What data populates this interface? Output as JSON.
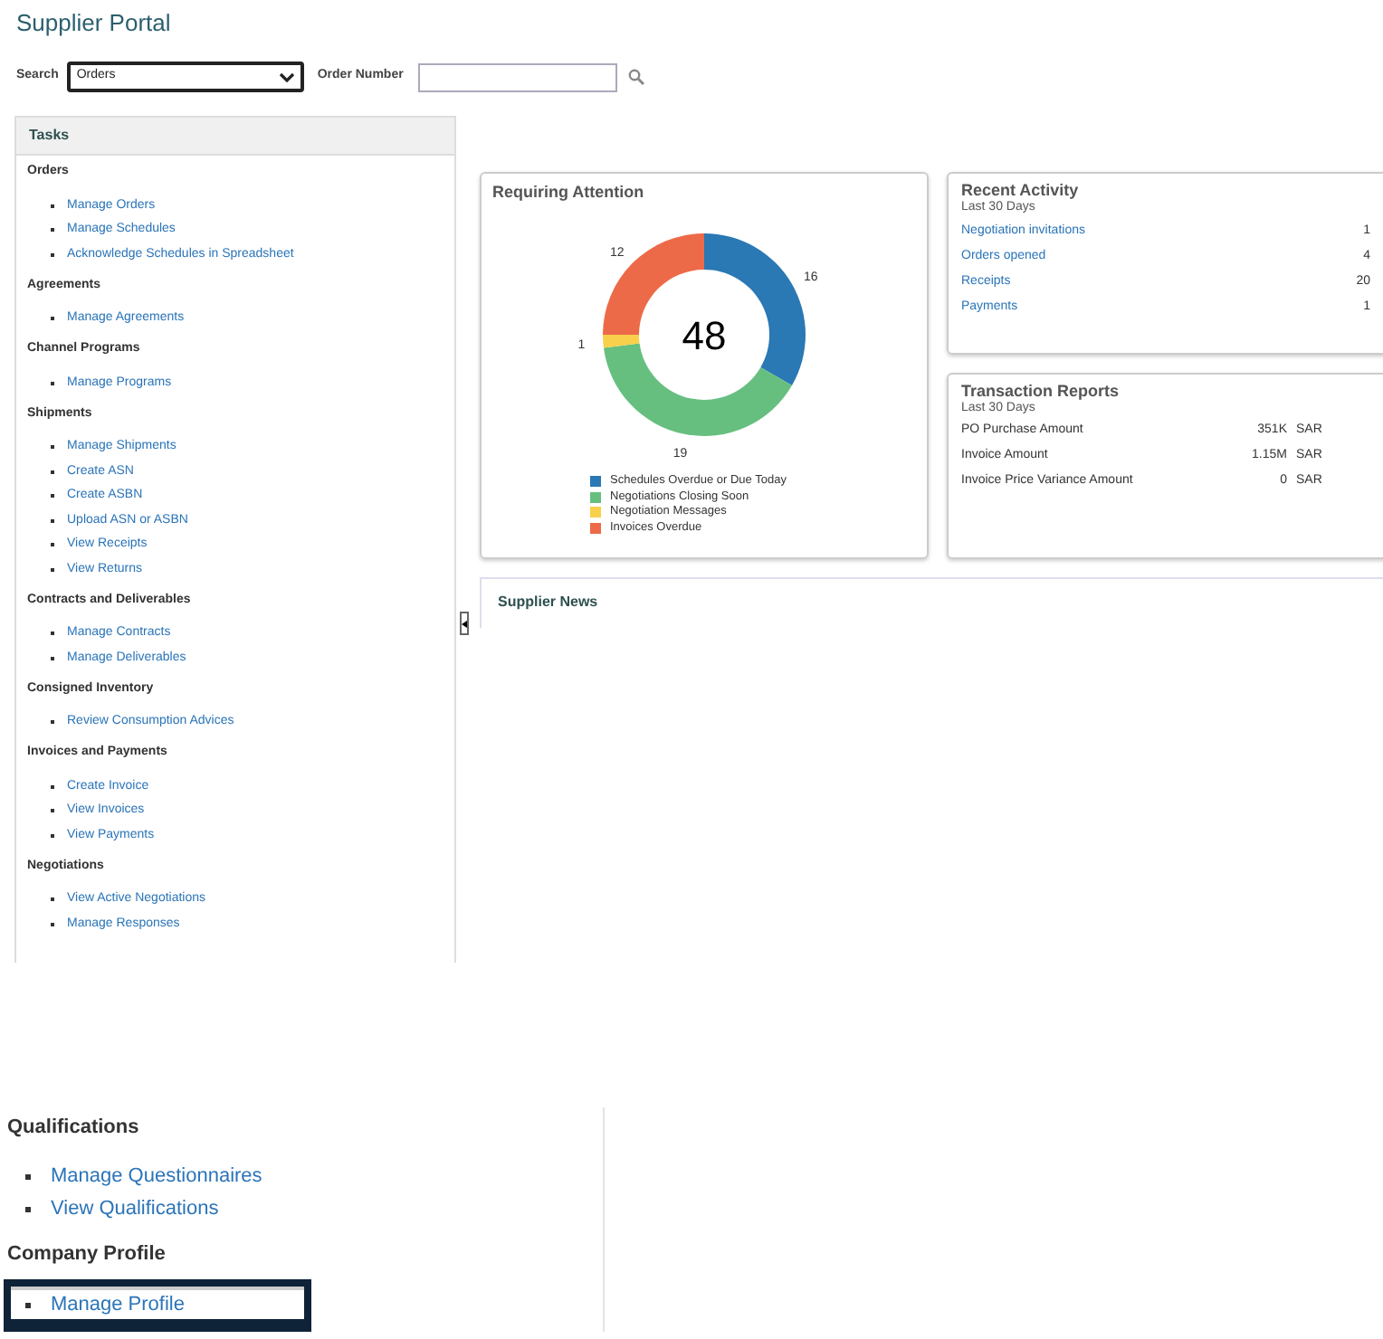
{
  "page_title": "Supplier Portal",
  "search": {
    "label": "Search",
    "value": "Orders",
    "order_number_label": "Order Number"
  },
  "tasks": {
    "title": "Tasks",
    "groups": [
      {
        "heading": "Orders",
        "links": [
          "Manage Orders",
          "Manage Schedules",
          "Acknowledge Schedules in Spreadsheet"
        ]
      },
      {
        "heading": "Agreements",
        "links": [
          "Manage Agreements"
        ]
      },
      {
        "heading": "Channel Programs",
        "links": [
          "Manage Programs"
        ]
      },
      {
        "heading": "Shipments",
        "links": [
          "Manage Shipments",
          "Create ASN",
          "Create ASBN",
          "Upload ASN or ASBN",
          "View Receipts",
          "View Returns"
        ]
      },
      {
        "heading": "Contracts and Deliverables",
        "links": [
          "Manage Contracts",
          "Manage Deliverables"
        ]
      },
      {
        "heading": "Consigned Inventory",
        "links": [
          "Review Consumption Advices"
        ]
      },
      {
        "heading": "Invoices and Payments",
        "links": [
          "Create Invoice",
          "View Invoices",
          "View Payments"
        ]
      },
      {
        "heading": "Negotiations",
        "links": [
          "View Active Negotiations",
          "Manage Responses"
        ]
      }
    ]
  },
  "requiring_attention": {
    "title": "Requiring Attention",
    "total": "48",
    "chart_data": {
      "type": "donut",
      "categories": [
        "Schedules Overdue or Due Today",
        "Negotiations Closing Soon",
        "Negotiation Messages",
        "Invoices Overdue"
      ],
      "values": [
        16,
        19,
        1,
        12
      ],
      "data_labels": true
    },
    "legend": [
      {
        "color": "#2a78b4"
      },
      {
        "color": "#66bf7f"
      },
      {
        "color": "#f8d04c"
      },
      {
        "color": "#ed6a48"
      }
    ]
  },
  "recent_activity": {
    "title": "Recent Activity",
    "subtitle": "Last 30 Days",
    "rows": [
      {
        "label": "Negotiation invitations",
        "value": "1"
      },
      {
        "label": "Orders opened",
        "value": "4"
      },
      {
        "label": "Receipts",
        "value": "20"
      },
      {
        "label": "Payments",
        "value": "1"
      }
    ]
  },
  "transaction_reports": {
    "title": "Transaction Reports",
    "subtitle": "Last 30 Days",
    "rows": [
      {
        "label": "PO Purchase Amount",
        "amount": "351K",
        "currency": "SAR"
      },
      {
        "label": "Invoice Amount",
        "amount": "1.15M",
        "currency": "SAR"
      },
      {
        "label": "Invoice Price Variance Amount",
        "amount": "0",
        "currency": "SAR"
      }
    ]
  },
  "supplier_news": {
    "title": "Supplier News"
  },
  "lower": {
    "groups": [
      {
        "heading": "Qualifications",
        "links": [
          {
            "label": "Manage Questionnaires",
            "highlighted": false
          },
          {
            "label": "View Qualifications",
            "highlighted": false
          }
        ]
      },
      {
        "heading": "Company Profile",
        "links": [
          {
            "label": "Manage Profile",
            "highlighted": true
          }
        ]
      }
    ]
  }
}
